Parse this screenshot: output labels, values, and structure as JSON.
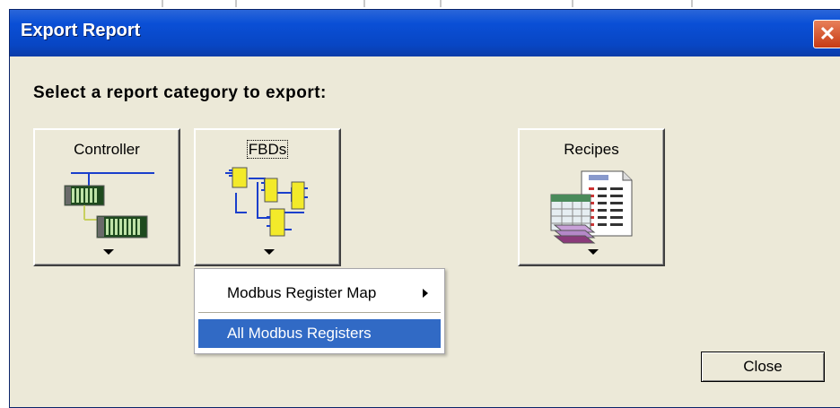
{
  "window": {
    "title": "Export Report",
    "close_glyph": "✕"
  },
  "prompt": "Select a report category to export:",
  "categories": [
    {
      "label": "Controller",
      "icon": "controller-icon"
    },
    {
      "label": "FBDs",
      "icon": "fbd-icon"
    },
    {
      "label": "Recipes",
      "icon": "recipes-icon"
    }
  ],
  "menu": {
    "items": [
      {
        "label": "Modbus Register Map",
        "has_submenu": true
      },
      {
        "label": "All Modbus Registers",
        "selected": true
      }
    ]
  },
  "buttons": {
    "close_label": "Close"
  },
  "colors": {
    "titlebar": "#0a4fd6",
    "selection": "#316ac5",
    "face": "#ece9d8"
  }
}
